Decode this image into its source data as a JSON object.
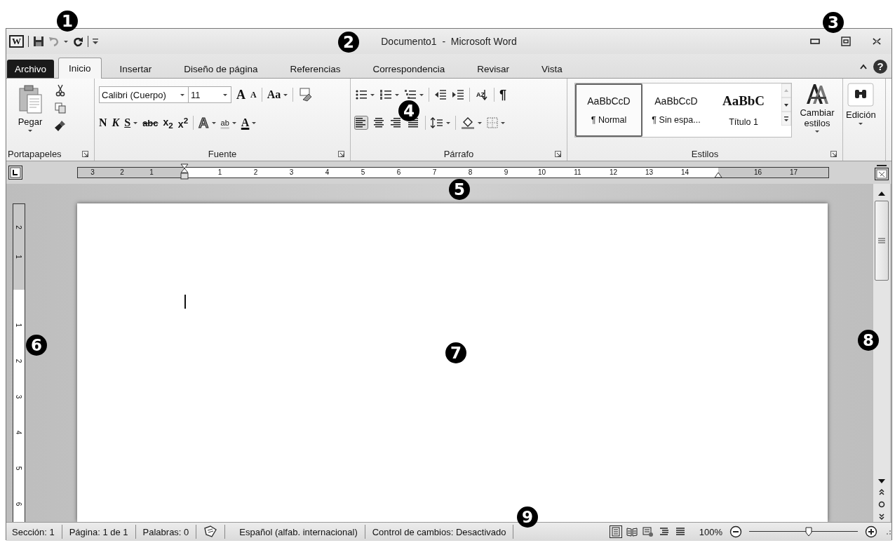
{
  "callouts": [
    "1",
    "2",
    "3",
    "4",
    "5",
    "6",
    "7",
    "8",
    "9"
  ],
  "app_icon": "W",
  "window": {
    "title": "Documento1  -  Microsoft Word"
  },
  "tabs": [
    {
      "label": "Archivo",
      "kind": "file",
      "selected": false
    },
    {
      "label": "Inicio",
      "kind": "tab",
      "selected": true
    },
    {
      "label": "Insertar",
      "kind": "tab",
      "selected": false
    },
    {
      "label": "Diseño de página",
      "kind": "tab",
      "selected": false
    },
    {
      "label": "Referencias",
      "kind": "tab",
      "selected": false
    },
    {
      "label": "Correspondencia",
      "kind": "tab",
      "selected": false
    },
    {
      "label": "Revisar",
      "kind": "tab",
      "selected": false
    },
    {
      "label": "Vista",
      "kind": "tab",
      "selected": false
    }
  ],
  "help": "?",
  "ribbon": {
    "clipboard": {
      "paste": "Pegar",
      "label": "Portapapeles"
    },
    "font": {
      "name": "Calibri (Cuerpo)",
      "size": "11",
      "grow": "A",
      "shrink": "A",
      "case": "Aa",
      "bold": "N",
      "italic": "K",
      "underline": "S",
      "strike": "abc",
      "subscript": "x$_{2}$",
      "superscript": "x$^{2}$",
      "effects": "A",
      "highlight": "ab",
      "font_color": "A",
      "label": "Fuente"
    },
    "paragraph": {
      "sort": "AZ",
      "marks": "¶",
      "alignments": [
        {
          "kind": "left",
          "selected": true
        },
        {
          "kind": "center",
          "selected": false
        },
        {
          "kind": "right",
          "selected": false
        },
        {
          "kind": "justify",
          "selected": false
        }
      ],
      "label": "Párrafo"
    },
    "styles": {
      "items": [
        {
          "preview": "AaBbCcD",
          "label": "¶ Normal",
          "kind": "body",
          "selected": true
        },
        {
          "preview": "AaBbCcD",
          "label": "¶ Sin espa...",
          "kind": "body",
          "selected": false
        },
        {
          "preview": "AaBbC",
          "label": "Título 1",
          "kind": "heading",
          "selected": false
        }
      ],
      "change": "Cambiar estilos",
      "label": "Estilos"
    },
    "editing": {
      "label": "Edición"
    }
  },
  "ruler": {
    "left_labels": [
      "3",
      "2",
      "1"
    ],
    "right_labels": [
      "1",
      "2",
      "3",
      "4",
      "5",
      "6",
      "7",
      "8",
      "9",
      "10",
      "11",
      "12",
      "13",
      "14"
    ],
    "outer_labels": [
      "16",
      "17"
    ]
  },
  "vertical_ruler": {
    "top_labels": [
      "2",
      "1"
    ],
    "labels": [
      "1",
      "2",
      "3",
      "4",
      "5",
      "6"
    ]
  },
  "status_bar": {
    "items": [
      "Sección: 1",
      "Página: 1 de 1",
      "Palabras: 0"
    ],
    "language": "Español (alfab. internacional)",
    "track_changes": "Control de cambios: Desactivado",
    "views": [
      {
        "kind": "print",
        "selected": true
      },
      {
        "kind": "reading",
        "selected": false
      },
      {
        "kind": "web",
        "selected": false
      },
      {
        "kind": "outline",
        "selected": false
      },
      {
        "kind": "draft",
        "selected": false
      }
    ],
    "zoom": {
      "reading": "100%",
      "level": 0.55
    }
  }
}
